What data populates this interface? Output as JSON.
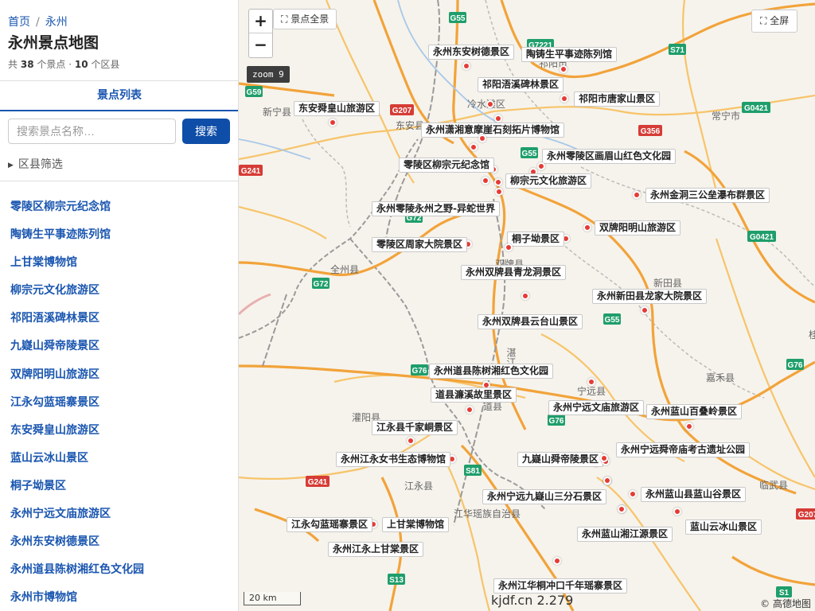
{
  "breadcrumb": {
    "home": "首页",
    "city": "永州",
    "separator": "/"
  },
  "header": {
    "title": "永州景点地图",
    "prefix": "共",
    "spot_count": "38",
    "spot_unit": "个景点 ·",
    "county_count": "10",
    "county_unit": "个区县"
  },
  "tab": {
    "label": "景点列表"
  },
  "search": {
    "placeholder": "搜索景点名称…",
    "value": "",
    "button_label": "搜索"
  },
  "filter": {
    "label": "区县筛选",
    "icon": "triangle-right-icon"
  },
  "spot_list": [
    "零陵区柳宗元纪念馆",
    "陶铸生平事迹陈列馆",
    "上甘棠博物馆",
    "柳宗元文化旅游区",
    "祁阳浯溪碑林景区",
    "九嶷山舜帝陵景区",
    "双牌阳明山旅游区",
    "江永勾蓝瑶寨景区",
    "东安舜皇山旅游区",
    "蓝山云冰山景区",
    "桐子坳景区",
    "永州宁远文庙旅游区",
    "永州东安树德景区",
    "永州道县陈树湘红色文化园",
    "永州市博物馆"
  ],
  "map": {
    "zoom_in": "+",
    "zoom_out": "−",
    "overview_label": "⛶ 景点全景",
    "fullscreen_label": "⛶ 全屏",
    "zoom_badge": "zoom 9",
    "scale": "20 km",
    "watermark": "kjdf.cn 2.279",
    "copyright": "© 高德地图",
    "marker_color": "#e63b35",
    "road_colors": {
      "highway": "#f2a33a",
      "national": "#f7c46a",
      "railway": "#aaaaaa",
      "border": "#9a9a9a"
    },
    "place_names": [
      "新宁县",
      "冷水滩区",
      "祁阳市",
      "常宁市",
      "东安县",
      "全州县",
      "双牌县",
      "新田县",
      "嘉禾县",
      "宁远县",
      "道县",
      "灌阳县",
      "江永县",
      "江华瑶族自治县",
      "临武县",
      "湛江线",
      "桂"
    ],
    "road_shields": [
      {
        "name": "G55",
        "color": "green"
      },
      {
        "name": "G7221",
        "color": "green"
      },
      {
        "name": "S71",
        "color": "green"
      },
      {
        "name": "G59",
        "color": "green"
      },
      {
        "name": "G207",
        "color": "red"
      },
      {
        "name": "G0421",
        "color": "green"
      },
      {
        "name": "G356",
        "color": "red"
      },
      {
        "name": "G55",
        "color": "green"
      },
      {
        "name": "G241",
        "color": "red"
      },
      {
        "name": "G72",
        "color": "green"
      },
      {
        "name": "G0421",
        "color": "green"
      },
      {
        "name": "G72",
        "color": "green"
      },
      {
        "name": "G55",
        "color": "green"
      },
      {
        "name": "G76",
        "color": "green"
      },
      {
        "name": "G76",
        "color": "green"
      },
      {
        "name": "G76",
        "color": "green"
      },
      {
        "name": "S81",
        "color": "green"
      },
      {
        "name": "G241",
        "color": "red"
      },
      {
        "name": "G207",
        "color": "red"
      },
      {
        "name": "S13",
        "color": "green"
      },
      {
        "name": "S1",
        "color": "green"
      }
    ],
    "pois": [
      "永州东安树德景区",
      "陶铸生平事迹陈列馆",
      "祁阳浯溪碑林景区",
      "祁阳市唐家山景区",
      "东安舜皇山旅游区",
      "永州潇湘意摩崖石刻拓片博物馆",
      "永州零陵区画眉山红色文化园",
      "零陵区柳宗元纪念馆",
      "柳宗元文化旅游区",
      "永州金洞三公垒瀑布群景区",
      "永州零陵永州之野-异蛇世界",
      "双牌阳明山旅游区",
      "桐子坳景区",
      "零陵区周家大院景区",
      "永州双牌县青龙洞景区",
      "永州新田县龙家大院景区",
      "永州双牌县云台山景区",
      "永州道县陈树湘红色文化园",
      "道县濂溪故里景区",
      "永州宁远文庙旅游区",
      "永州蓝山百叠岭景区",
      "江永县千家峒景区",
      "永州宁远舜帝庙考古遗址公园",
      "永州江永女书生态博物馆",
      "九嶷山舜帝陵景区",
      "永州宁远九嶷山三分石景区",
      "永州蓝山县蓝山谷景区",
      "江永勾蓝瑶寨景区",
      "上甘棠博物馆",
      "永州蓝山湘江源景区",
      "蓝山云冰山景区",
      "永州江永上甘棠景区",
      "永州江华桐冲口千年瑶寨景区"
    ]
  }
}
